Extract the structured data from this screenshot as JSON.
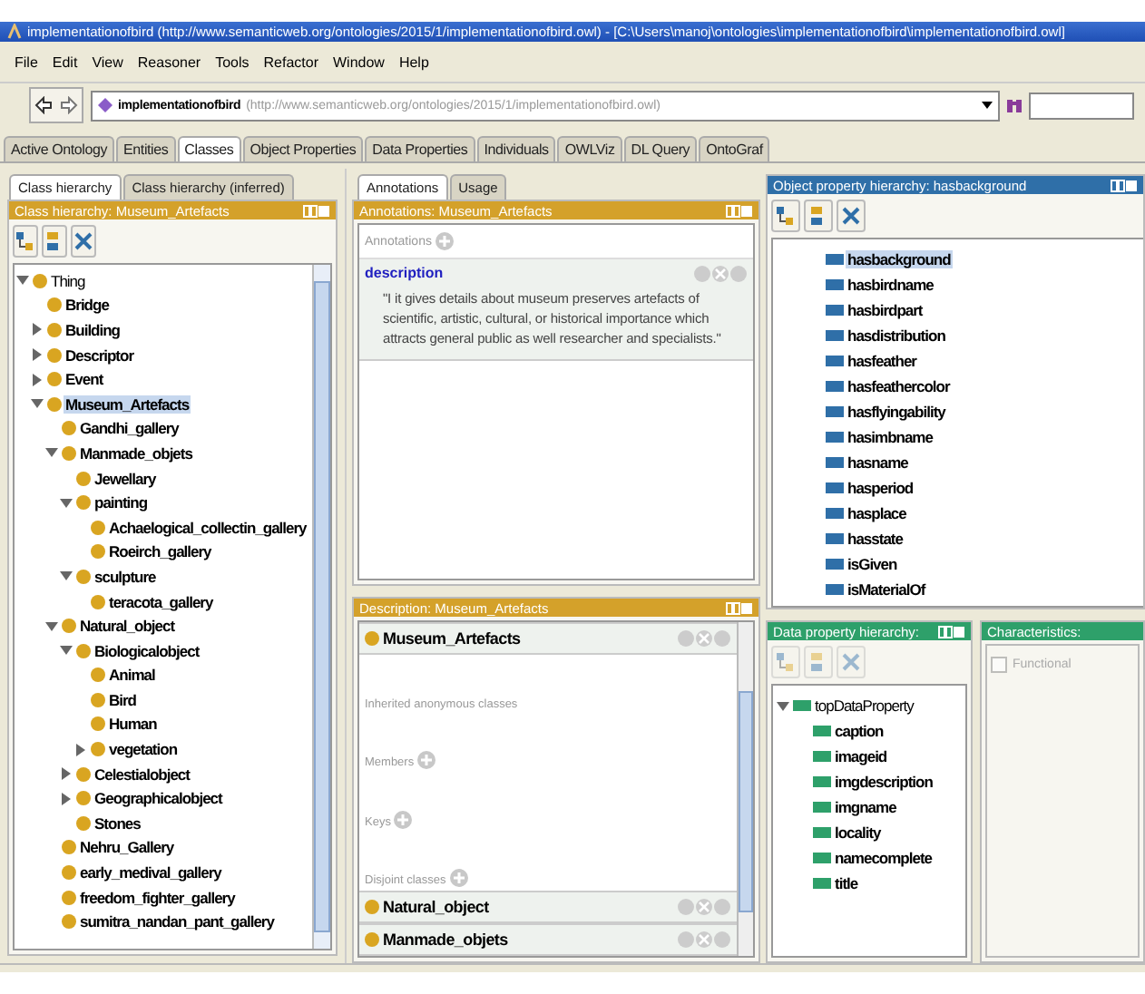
{
  "window": {
    "title": "implementationofbird (http://www.semanticweb.org/ontologies/2015/1/implementationofbird.owl) - [C:\\Users\\manoj\\ontologies\\implementationofbird\\implementationofbird.owl]"
  },
  "menu": [
    "File",
    "Edit",
    "View",
    "Reasoner",
    "Tools",
    "Refactor",
    "Window",
    "Help"
  ],
  "address": {
    "ontology": "implementationofbird",
    "iri": "(http://www.semanticweb.org/ontologies/2015/1/implementationofbird.owl)"
  },
  "tabs": [
    {
      "label": "Active Ontology",
      "selected": false
    },
    {
      "label": "Entities",
      "selected": false
    },
    {
      "label": "Classes",
      "selected": true
    },
    {
      "label": "Object Properties",
      "selected": false
    },
    {
      "label": "Data Properties",
      "selected": false
    },
    {
      "label": "Individuals",
      "selected": false
    },
    {
      "label": "OWLViz",
      "selected": false
    },
    {
      "label": "DL Query",
      "selected": false
    },
    {
      "label": "OntoGraf",
      "selected": false
    }
  ],
  "class_panel": {
    "tabs": [
      {
        "label": "Class hierarchy",
        "selected": true
      },
      {
        "label": "Class hierarchy (inferred)",
        "selected": false
      }
    ],
    "title": "Class hierarchy: Museum_Artefacts",
    "tree": [
      {
        "label": "Thing",
        "expanded": true,
        "selected": false,
        "children": [
          {
            "label": "Bridge",
            "selected": false
          },
          {
            "label": "Building",
            "expanded": false,
            "selected": false
          },
          {
            "label": "Descriptor",
            "expanded": false,
            "selected": false
          },
          {
            "label": "Event",
            "expanded": false,
            "selected": false
          },
          {
            "label": "Museum_Artefacts",
            "expanded": true,
            "selected": true,
            "children": [
              {
                "label": "Gandhi_gallery",
                "selected": false
              },
              {
                "label": "Manmade_objets",
                "expanded": true,
                "selected": false,
                "children": [
                  {
                    "label": "Jewellary",
                    "selected": false
                  },
                  {
                    "label": "painting",
                    "expanded": true,
                    "selected": false,
                    "children": [
                      {
                        "label": "Achaelogical_collectin_gallery",
                        "selected": false
                      },
                      {
                        "label": "Roeirch_gallery",
                        "selected": false
                      }
                    ]
                  },
                  {
                    "label": "sculpture",
                    "expanded": true,
                    "selected": false,
                    "children": [
                      {
                        "label": "teracota_gallery",
                        "selected": false
                      }
                    ]
                  }
                ]
              },
              {
                "label": "Natural_object",
                "expanded": true,
                "selected": false,
                "children": [
                  {
                    "label": "Biologicalobject",
                    "expanded": true,
                    "selected": false,
                    "children": [
                      {
                        "label": "Animal",
                        "selected": false
                      },
                      {
                        "label": "Bird",
                        "selected": false
                      },
                      {
                        "label": "Human",
                        "selected": false
                      },
                      {
                        "label": "vegetation",
                        "expanded": false,
                        "selected": false
                      }
                    ]
                  },
                  {
                    "label": "Celestialobject",
                    "expanded": false,
                    "selected": false
                  },
                  {
                    "label": "Geographicalobject",
                    "expanded": false,
                    "selected": false
                  },
                  {
                    "label": "Stones",
                    "selected": false
                  }
                ]
              },
              {
                "label": "Nehru_Gallery",
                "selected": false
              },
              {
                "label": "early_medival_gallery",
                "selected": false
              },
              {
                "label": "freedom_fighter_gallery",
                "selected": false
              },
              {
                "label": "sumitra_nandan_pant_gallery",
                "selected": false
              }
            ]
          }
        ]
      }
    ]
  },
  "annotations_panel": {
    "tabs": [
      {
        "label": "Annotations",
        "selected": true
      },
      {
        "label": "Usage",
        "selected": false
      }
    ],
    "title": "Annotations: Museum_Artefacts",
    "section_label": "Annotations",
    "annotations": [
      {
        "property": "description",
        "value": "\"I it gives details about museum preserves artefacts of scientific, artistic, cultural, or historical importance which attracts general public as well researcher and specialists.\""
      }
    ]
  },
  "description_panel": {
    "title": "Description: Museum_Artefacts",
    "frames": [
      {
        "kind": "class",
        "label": "Museum_Artefacts"
      },
      {
        "kind": "section",
        "label": "Inherited anonymous classes",
        "addable": false
      },
      {
        "kind": "section",
        "label": "Members",
        "addable": true
      },
      {
        "kind": "section",
        "label": "Keys",
        "addable": true
      },
      {
        "kind": "section",
        "label": "Disjoint classes",
        "addable": true
      },
      {
        "kind": "class",
        "label": "Natural_object"
      },
      {
        "kind": "class",
        "label": "Manmade_objets"
      }
    ]
  },
  "object_property_panel": {
    "title": "Object property hierarchy: hasbackground",
    "properties": [
      {
        "label": "hasbackground",
        "selected": true
      },
      {
        "label": "hasbirdname",
        "selected": false
      },
      {
        "label": "hasbirdpart",
        "selected": false
      },
      {
        "label": "hasdistribution",
        "selected": false
      },
      {
        "label": "hasfeather",
        "selected": false
      },
      {
        "label": "hasfeathercolor",
        "selected": false
      },
      {
        "label": "hasflyingability",
        "selected": false
      },
      {
        "label": "hasimbname",
        "selected": false
      },
      {
        "label": "hasname",
        "selected": false
      },
      {
        "label": "hasperiod",
        "selected": false
      },
      {
        "label": "hasplace",
        "selected": false
      },
      {
        "label": "hasstate",
        "selected": false
      },
      {
        "label": "isGiven",
        "selected": false
      },
      {
        "label": "isMaterialOf",
        "selected": false
      }
    ]
  },
  "data_property_panel": {
    "title": "Data property hierarchy:",
    "toolbar_disabled": true,
    "tree": [
      {
        "label": "topDataProperty",
        "expanded": true,
        "selected": false,
        "children": [
          {
            "label": "caption",
            "selected": false
          },
          {
            "label": "imageid",
            "selected": false
          },
          {
            "label": "imgdescription",
            "selected": false
          },
          {
            "label": "imgname",
            "selected": false
          },
          {
            "label": "locality",
            "selected": false
          },
          {
            "label": "namecomplete",
            "selected": false
          },
          {
            "label": "title",
            "selected": false
          }
        ]
      }
    ]
  },
  "characteristics_panel": {
    "title": "Characteristics:",
    "items": [
      {
        "label": "Functional",
        "checked": false,
        "disabled": true
      }
    ]
  }
}
